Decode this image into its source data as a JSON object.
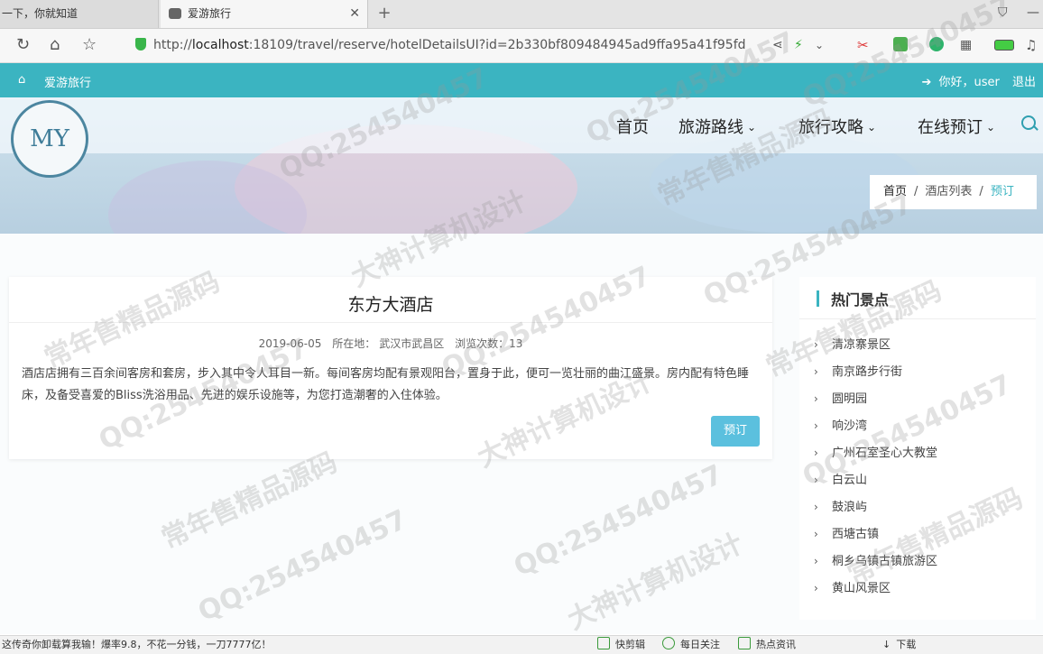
{
  "browser": {
    "tabs": [
      {
        "title": "一下，你就知道",
        "active": false
      },
      {
        "title": "爱游旅行",
        "active": true
      }
    ],
    "url_prefix": "http://",
    "url_host": "localhost",
    "url_rest": ":18109/travel/reserve/hotelDetailsUI?id=2b330bf809484945ad9ffa95a41f95fd"
  },
  "topstrip": {
    "brand": "爱游旅行",
    "greeting": "你好，user",
    "logout": "退出"
  },
  "header": {
    "logo_text": "MY",
    "nav": [
      {
        "label": "首页",
        "dropdown": false
      },
      {
        "label": "旅游路线",
        "dropdown": true
      },
      {
        "label": "旅行攻略",
        "dropdown": true
      },
      {
        "label": "在线预订",
        "dropdown": true
      }
    ]
  },
  "breadcrumb": {
    "home": "首页",
    "list": "酒店列表",
    "current": "预订",
    "separator": "/"
  },
  "hotel": {
    "name": "东方大酒店",
    "date": "2019-06-05",
    "location_label": "所在地：",
    "location": "武汉市武昌区",
    "views_label": "浏览次数：",
    "views": "13",
    "description": "酒店店拥有三百余间客房和套房，步入其中令人耳目一新。每间客房均配有景观阳台，置身于此，便可一览壮丽的曲江盛景。房内配有特色睡床，及备受喜爱的Bliss洗浴用品、先进的娱乐设施等，为您打造潮奢的入住体验。",
    "reserve_label": "预订"
  },
  "sidebar": {
    "title": "热门景点",
    "items": [
      "清凉寨景区",
      "南京路步行街",
      "圆明园",
      "响沙湾",
      "广州石室圣心大教堂",
      "白云山",
      "鼓浪屿",
      "西塘古镇",
      "桐乡乌镇古镇旅游区",
      "黄山风景区"
    ]
  },
  "statusbar": {
    "ticker": "这传奇你卸载算我输！爆率9.8，不花一分钱，一刀7777亿！",
    "items": [
      "快剪辑",
      "每日关注",
      "热点资讯",
      "下载"
    ]
  },
  "watermarks": [
    "常年售精品源码",
    "QQ:254540457",
    "大神计算机设计"
  ],
  "colors": {
    "accent": "#3bb4c1",
    "button": "#5bc0de"
  }
}
